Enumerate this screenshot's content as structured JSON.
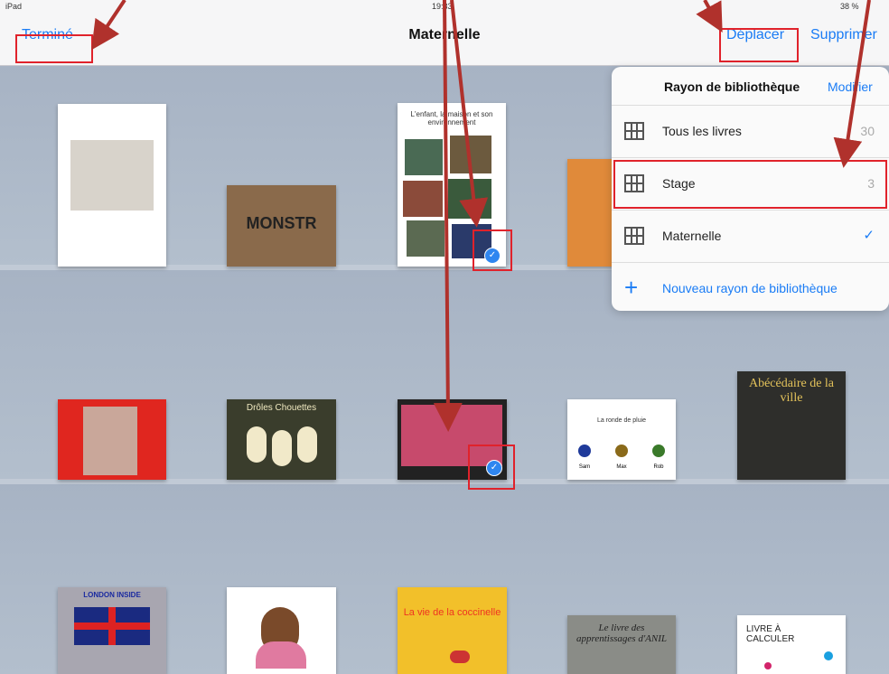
{
  "status": {
    "left": "iPad",
    "time": "19:33",
    "battery": "38 %"
  },
  "nav": {
    "done": "Terminé",
    "title": "Maternelle",
    "move": "Déplacer",
    "delete": "Supprimer"
  },
  "popover": {
    "title": "Rayon de bibliothèque",
    "edit": "Modifier",
    "rows": [
      {
        "label": "Tous les livres",
        "count": "30"
      },
      {
        "label": "Stage",
        "count": "3"
      },
      {
        "label": "Maternelle",
        "check": "✓"
      }
    ],
    "new_label": "Nouveau rayon de bibliothèque"
  },
  "books": {
    "b3_text": "L'enfant, la maison et son environnement",
    "monster": "MONSTR",
    "owls": "Drôles Chouettes",
    "pluie": "La ronde de pluie",
    "names": [
      "Sam",
      "Max",
      "Rob"
    ],
    "abecedaire": "Abécédaire de la ville",
    "london": "LONDON INSIDE",
    "coccinelle": "La vie de la coccinelle",
    "apprentissages": "Le livre des apprentissages d'ANIL",
    "calculer": "LIVRE À CALCULER"
  },
  "colors": {
    "accent": "#1a7cf5",
    "annotation": "#e0222b",
    "arrow": "#b0312c"
  }
}
